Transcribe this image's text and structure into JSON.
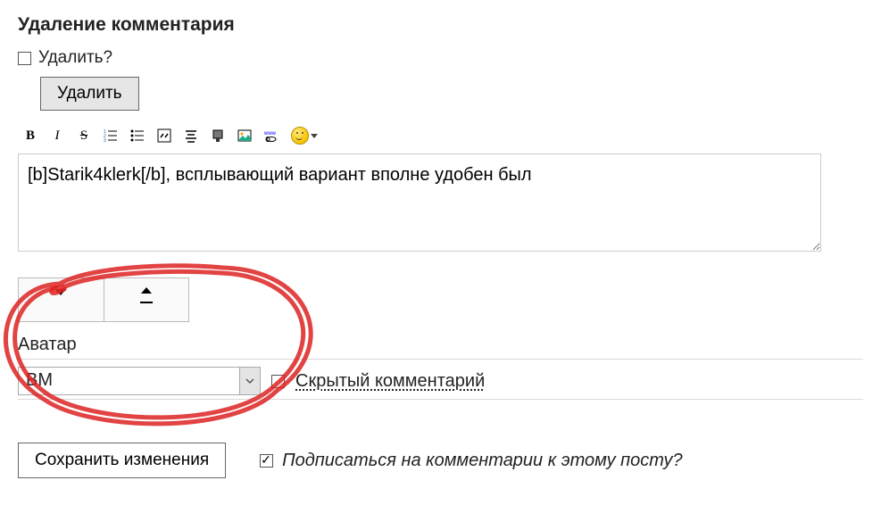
{
  "title": "Удаление комментария",
  "deleteQuestion": "Удалить?",
  "deleteButton": "Удалить",
  "toolbar": {
    "bold": "B",
    "italic": "I",
    "strike": "S"
  },
  "editorText": "[b]Starik4klerk[/b], всплывающий вариант вполне удобен был",
  "avatar": {
    "label": "Аватар",
    "selected": "BM"
  },
  "hiddenComment": {
    "label": "Скрытый комментарий",
    "checked": false
  },
  "saveButton": "Сохранить изменения",
  "subscribe": {
    "label": "Подписаться на комментарии к этому посту?",
    "checked": true
  }
}
